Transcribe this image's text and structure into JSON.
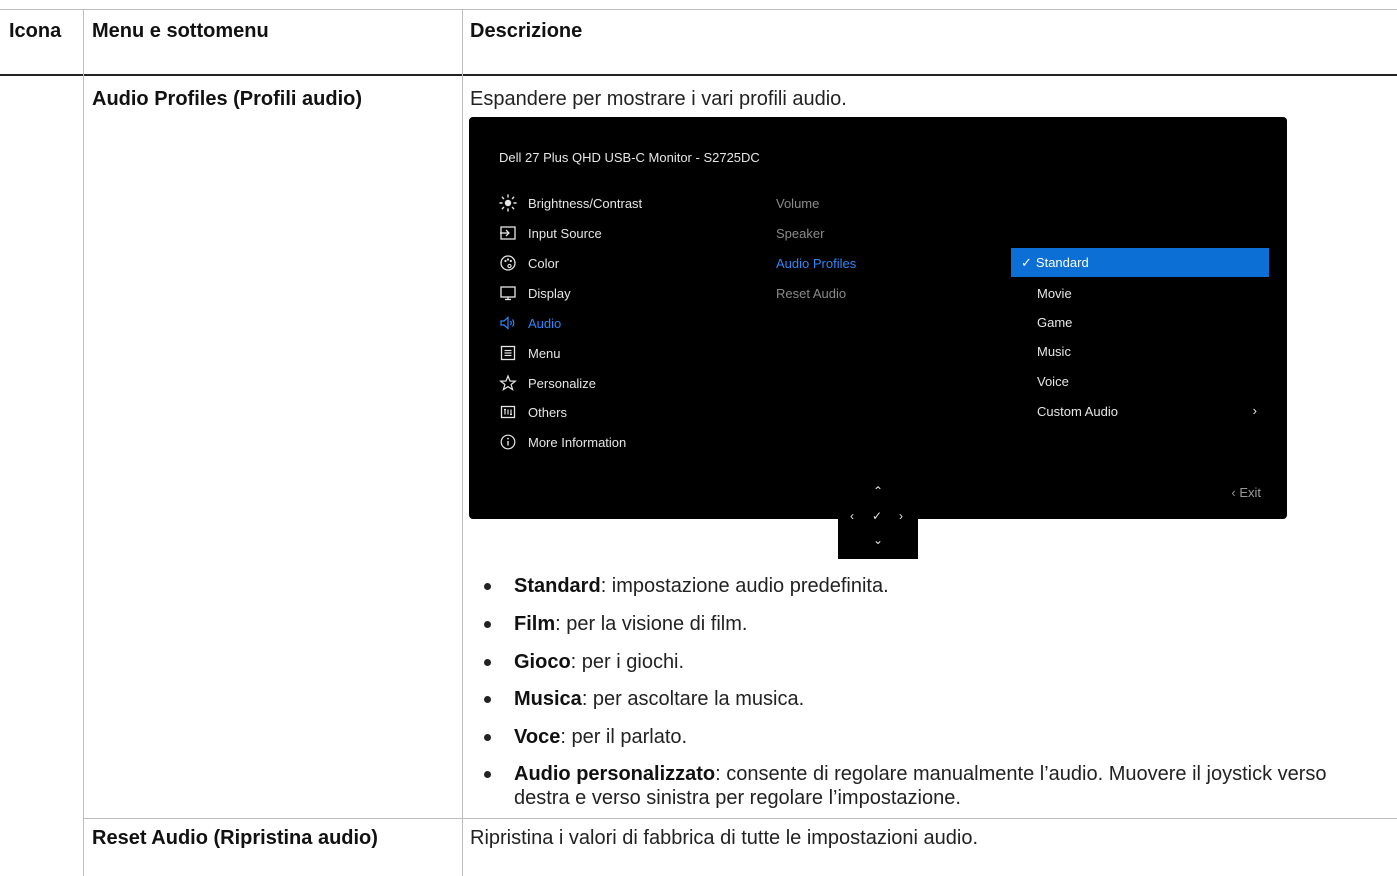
{
  "table": {
    "headers": [
      "Icona",
      "Menu e sottomenu",
      "Descrizione"
    ],
    "rows": [
      {
        "menu": "Audio Profiles (Profili audio)",
        "description": "Espandere per mostrare i vari profili audio."
      },
      {
        "menu": "Reset Audio (Ripristina audio)",
        "description": "Ripristina i valori di fabbrica di tutte le impostazioni audio."
      }
    ]
  },
  "osd": {
    "title": "Dell 27 Plus QHD USB-C Monitor - S2725DC",
    "menu": [
      {
        "icon": "sun-icon",
        "label": "Brightness/Contrast"
      },
      {
        "icon": "input-source-icon",
        "label": "Input Source"
      },
      {
        "icon": "palette-icon",
        "label": "Color"
      },
      {
        "icon": "monitor-icon",
        "label": "Display"
      },
      {
        "icon": "speaker-icon",
        "label": "Audio",
        "active": true
      },
      {
        "icon": "menu-list-icon",
        "label": "Menu"
      },
      {
        "icon": "star-icon",
        "label": "Personalize"
      },
      {
        "icon": "others-icon",
        "label": "Others"
      },
      {
        "icon": "info-icon",
        "label": "More Information"
      }
    ],
    "submenu": [
      {
        "label": "Volume"
      },
      {
        "label": "Speaker"
      },
      {
        "label": "Audio Profiles",
        "active": true
      },
      {
        "label": "Reset Audio"
      }
    ],
    "options": [
      {
        "label": "Standard",
        "selected": true
      },
      {
        "label": "Movie"
      },
      {
        "label": "Game"
      },
      {
        "label": "Music"
      },
      {
        "label": "Voice"
      },
      {
        "label": "Custom Audio"
      }
    ],
    "exit_label": "Exit",
    "accent_color": "#2f86f6",
    "selection_color": "#0b6fd6"
  },
  "bullets": [
    {
      "term": "Standard",
      "text": ": impostazione audio predefinita."
    },
    {
      "term": "Film",
      "text": ": per la visione di film."
    },
    {
      "term": "Gioco",
      "text": ": per i giochi."
    },
    {
      "term": "Musica",
      "text": ": per ascoltare la musica."
    },
    {
      "term": "Voce",
      "text": ": per il parlato."
    },
    {
      "term": "Audio personalizzato",
      "text": ": consente di regolare manualmente l’audio. Muovere il joystick verso destra e verso sinistra per regolare l’impostazione."
    }
  ]
}
